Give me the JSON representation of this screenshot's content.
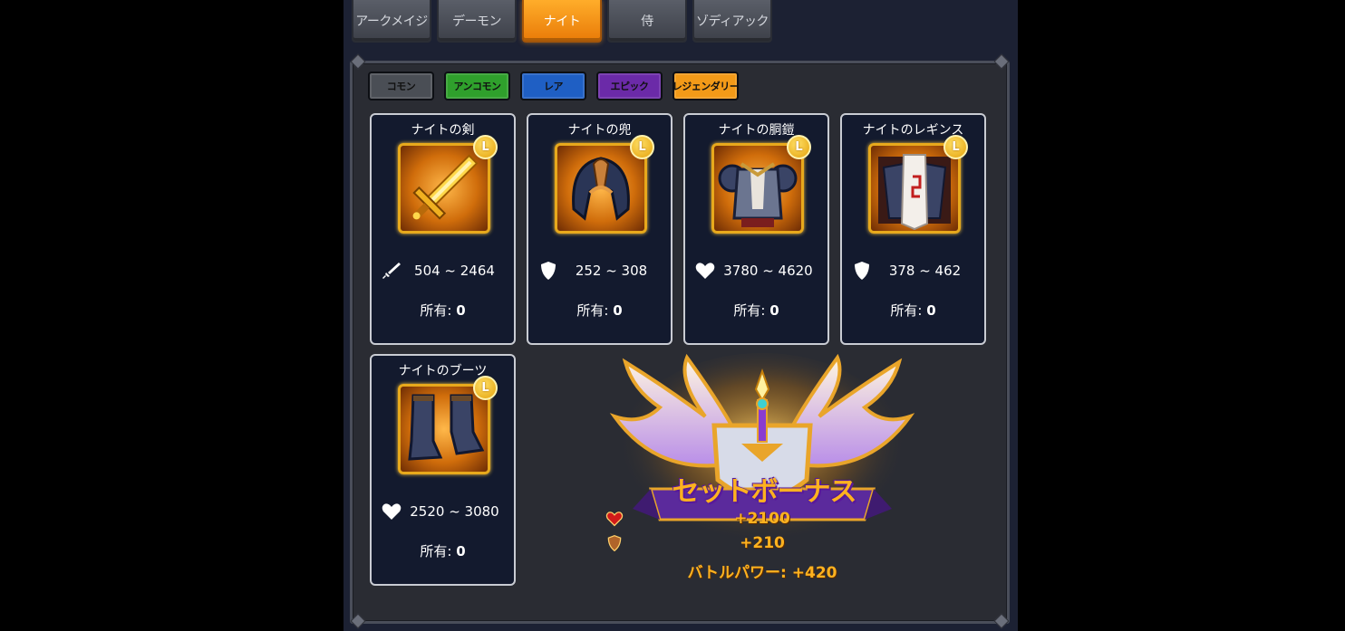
{
  "class_tabs": [
    {
      "label": "アークメイジ",
      "active": false
    },
    {
      "label": "デーモン",
      "active": false
    },
    {
      "label": "ナイト",
      "active": true
    },
    {
      "label": "侍",
      "active": false
    },
    {
      "label": "ゾディアック",
      "active": false
    }
  ],
  "rarity_tabs": [
    {
      "label": "コモン",
      "color": "#4a4e55"
    },
    {
      "label": "アンコモン",
      "color": "#2fa02c"
    },
    {
      "label": "レア",
      "color": "#1f5fc4"
    },
    {
      "label": "エピック",
      "color": "#6b2aa8"
    },
    {
      "label": "レジェンダリー",
      "color": "#f39a18"
    }
  ],
  "items": [
    {
      "name": "ナイトの剣",
      "badge": "L",
      "stat_icon": "sword-icon",
      "stat_range": "504 ~ 2464",
      "owned_label": "所有:",
      "owned_value": "0"
    },
    {
      "name": "ナイトの兜",
      "badge": "L",
      "stat_icon": "shield-icon",
      "stat_range": "252 ~ 308",
      "owned_label": "所有:",
      "owned_value": "0"
    },
    {
      "name": "ナイトの胴鎧",
      "badge": "L",
      "stat_icon": "heart-icon",
      "stat_range": "3780 ~ 4620",
      "owned_label": "所有:",
      "owned_value": "0"
    },
    {
      "name": "ナイトのレギンス",
      "badge": "L",
      "stat_icon": "shield-icon",
      "stat_range": "378 ~ 462",
      "owned_label": "所有:",
      "owned_value": "0"
    },
    {
      "name": "ナイトのブーツ",
      "badge": "L",
      "stat_icon": "heart-icon",
      "stat_range": "2520 ~ 3080",
      "owned_label": "所有:",
      "owned_value": "0"
    }
  ],
  "set_bonus": {
    "title": "セットボーナス",
    "hp_bonus": "+2100",
    "def_bonus": "+210",
    "battle_power": "バトルパワー: +420"
  },
  "colors": {
    "accent_orange": "#f39a18",
    "legendary_gold": "#e8a91c",
    "card_bg": "#131a2e"
  }
}
